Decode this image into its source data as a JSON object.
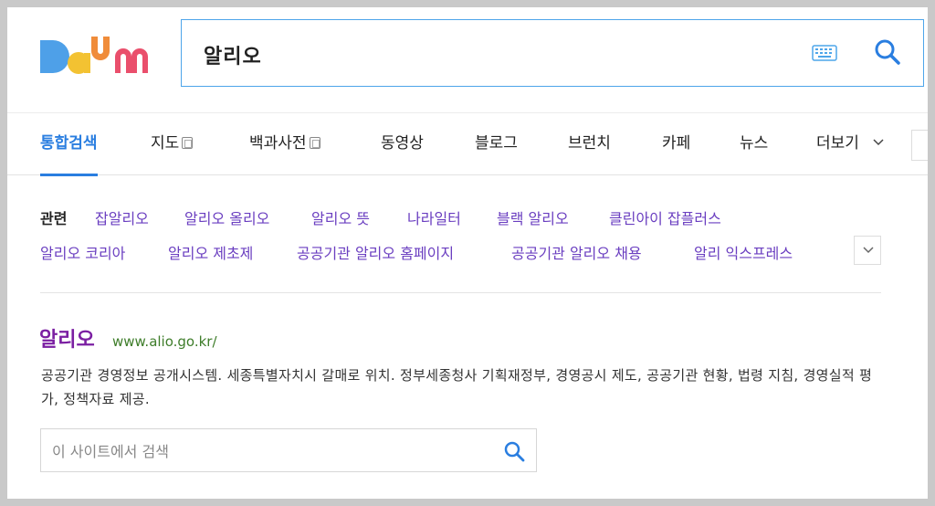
{
  "header": {
    "logo_text": "Daum",
    "search": {
      "query": "알리오"
    }
  },
  "tabs": [
    {
      "label": "통합검색",
      "active": true
    },
    {
      "label": "지도"
    },
    {
      "label": "백과사전"
    },
    {
      "label": "동영상"
    },
    {
      "label": "블로그"
    },
    {
      "label": "브런치"
    },
    {
      "label": "카페"
    },
    {
      "label": "뉴스"
    },
    {
      "label": "더보기"
    }
  ],
  "related": {
    "label": "관련",
    "links": [
      "잡알리오",
      "알리오 올리오",
      "알리오 뜻",
      "나라일터",
      "블랙 알리오",
      "클린아이 잡플러스",
      "알리오 코리아",
      "알리오 제초제",
      "공공기관 알리오 홈페이지",
      "공공기관 알리오 채용",
      "알리 익스프레스"
    ]
  },
  "result": {
    "title": "알리오",
    "url": "www.alio.go.kr/",
    "description": "공공기관 경영정보 공개시스템. 세종특별자치시 갈매로 위치. 정부세종청사 기획재정부, 경영공시 제도, 공공기관 현황, 법령 지침, 경영실적 평가, 정책자료 제공.",
    "site_search_placeholder": "이 사이트에서 검색"
  },
  "colors": {
    "accent": "#2a7ee0",
    "related_link": "#6a3ec0",
    "result_title": "#7b1fa2",
    "url": "#3e7d2a"
  }
}
